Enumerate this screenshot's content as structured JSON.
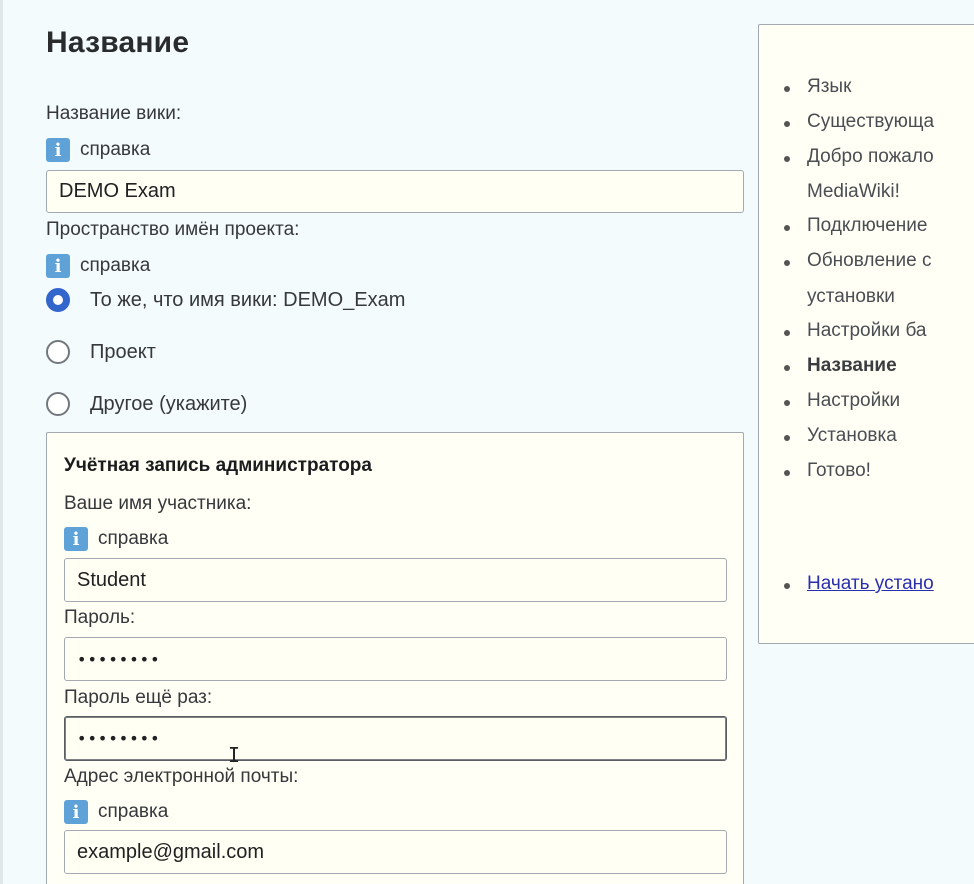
{
  "page": {
    "title": "Название"
  },
  "wiki_name": {
    "label": "Название вики:",
    "help": "справка",
    "value": "DEMO Exam"
  },
  "namespace": {
    "label": "Пространство имён проекта:",
    "help": "справка",
    "options": [
      {
        "label": "То же, что имя вики: DEMO_Exam",
        "checked": true
      },
      {
        "label": "Проект",
        "checked": false
      },
      {
        "label": "Другое (укажите)",
        "checked": false
      }
    ]
  },
  "admin": {
    "legend": "Учётная запись администратора",
    "username_label": "Ваше имя участника:",
    "username_help": "справка",
    "username_value": "Student",
    "password_label": "Пароль:",
    "password_value": "••••••••",
    "password2_label": "Пароль ещё раз:",
    "password2_value": "••••••••",
    "email_label": "Адрес электронной почты:",
    "email_help": "справка",
    "email_value": "example@gmail.com"
  },
  "icons": {
    "info": "info-icon",
    "cursor": "text-cursor-icon"
  },
  "sidebar": {
    "items": [
      {
        "label": "Язык"
      },
      {
        "label": "Существующа"
      },
      {
        "label": "Добро пожало"
      },
      {
        "label": "MediaWiki!"
      },
      {
        "label": "Подключение"
      },
      {
        "label": "Обновление с"
      },
      {
        "label": "установки"
      },
      {
        "label": "Настройки ба"
      },
      {
        "label": "Название"
      },
      {
        "label": "Настройки"
      },
      {
        "label": "Установка"
      },
      {
        "label": "Готово!"
      }
    ],
    "start_link": "Начать устано"
  },
  "colors": {
    "accent": "#3366cc",
    "background": "#f3fbfd",
    "panel": "#fffff6",
    "link": "#2a2fad",
    "info_icon": "#5fa2d8"
  }
}
